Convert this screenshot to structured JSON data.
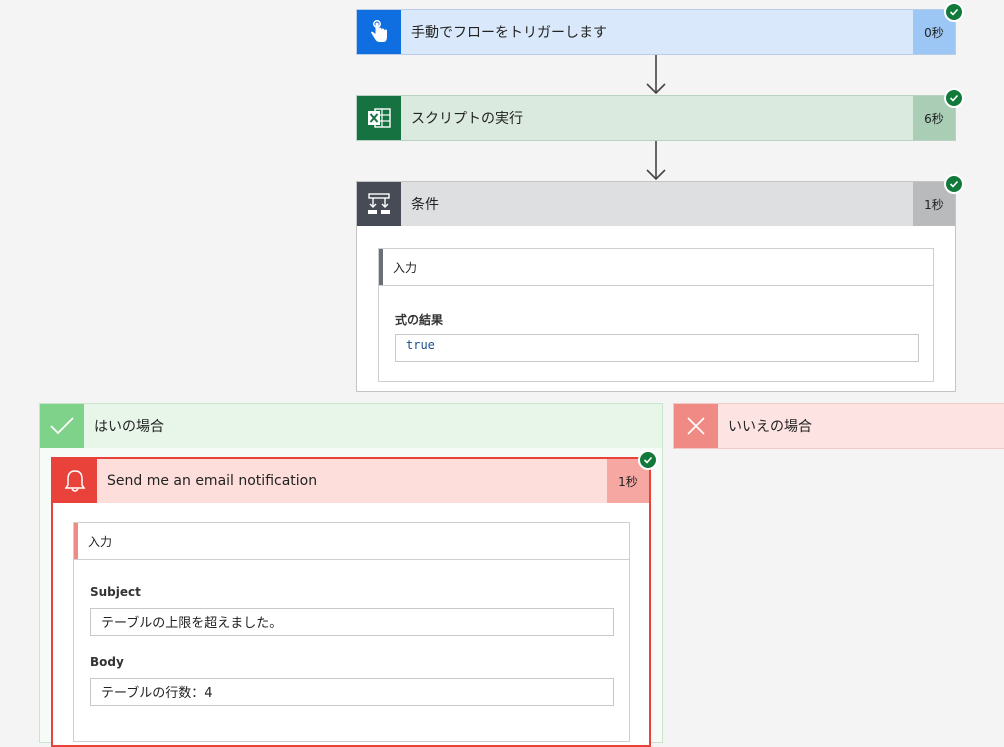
{
  "flow": {
    "trigger": {
      "title": "手動でフローをトリガーします",
      "duration": "0秒",
      "icon": "touch-icon"
    },
    "script": {
      "title": "スクリプトの実行",
      "duration": "6秒",
      "icon": "excel-icon"
    },
    "condition": {
      "title": "条件",
      "duration": "1秒",
      "icon": "condition-icon",
      "inputs_label": "入力",
      "expression_label": "式の結果",
      "expression_value": "true"
    },
    "yes_branch": {
      "title": "はいの場合",
      "icon": "check-icon"
    },
    "no_branch": {
      "title": "いいえの場合",
      "icon": "close-icon"
    },
    "notification": {
      "title": "Send me an email notification",
      "duration": "1秒",
      "icon": "bell-icon",
      "inputs_label": "入力",
      "subject_label": "Subject",
      "subject_value": "テーブルの上限を超えました。",
      "body_label": "Body",
      "body_value": "テーブルの行数：4"
    }
  },
  "colors": {
    "trigger_accent": "#0f6fe0",
    "trigger_bg": "#d9e9fb",
    "trigger_dur": "#9cc6f3",
    "excel_accent": "#177242",
    "excel_bg": "#dbeadf",
    "excel_dur": "#a9cdb5",
    "condition_accent": "#474b55",
    "condition_bg": "#dedfe1",
    "condition_dur": "#b9babc",
    "yes_accent": "#7fd28a",
    "yes_bg": "#e8f6ea",
    "no_accent": "#f08a84",
    "no_bg": "#fde4e2",
    "notify_accent": "#e8423a",
    "notify_bg": "#fddedb",
    "notify_dur": "#f6a7a2",
    "success": "#117a3a"
  }
}
